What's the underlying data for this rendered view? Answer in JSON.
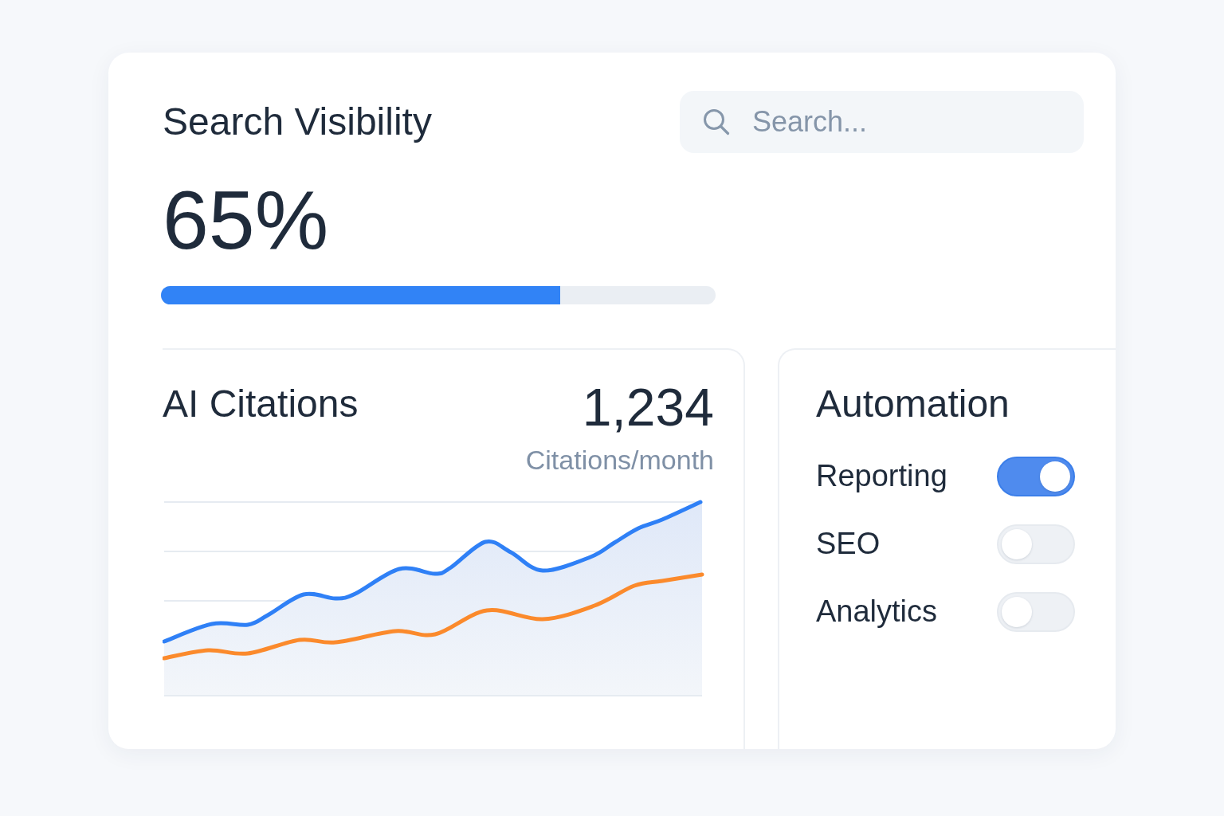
{
  "card": {
    "title": "Search Visibility",
    "search": {
      "placeholder": "Search..."
    },
    "score": {
      "value": "65%",
      "level": 0.72
    }
  },
  "citations": {
    "title": "AI Citations",
    "count": "1,234",
    "unit": "Citations/month"
  },
  "automation": {
    "title": "Automation",
    "toggles": [
      {
        "label": "Reporting",
        "on": true
      },
      {
        "label": "SEO",
        "on": false
      },
      {
        "label": "Analytics",
        "on": false
      }
    ]
  }
}
